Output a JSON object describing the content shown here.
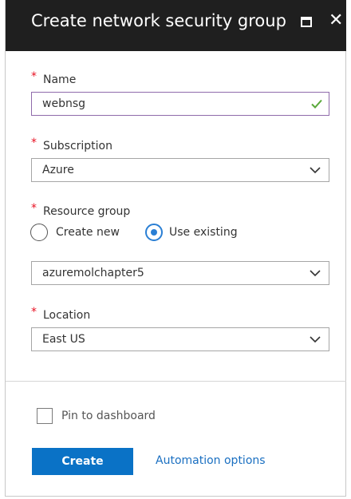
{
  "header": {
    "title": "Create network security group"
  },
  "form": {
    "name": {
      "required_mark": "*",
      "label": "Name",
      "value": "webnsg"
    },
    "subscription": {
      "required_mark": "*",
      "label": "Subscription",
      "selected": "Azure"
    },
    "resource_group": {
      "required_mark": "*",
      "label": "Resource group",
      "options": [
        {
          "label": "Create new",
          "selected": false
        },
        {
          "label": "Use existing",
          "selected": true
        }
      ],
      "selected": "azuremolchapter5"
    },
    "location": {
      "required_mark": "*",
      "label": "Location",
      "selected": "East US"
    }
  },
  "footer": {
    "pin_label": "Pin to dashboard",
    "pin_checked": false,
    "create_label": "Create",
    "automation_label": "Automation options"
  },
  "colors": {
    "header_bg": "#1f1f1f",
    "required": "#e81123",
    "primary_button": "#0a72c6",
    "link": "#1a6fc1",
    "valid_check": "#5aa93b",
    "radio_selected": "#2a7fd4"
  },
  "icons": {
    "maximize": "maximize-icon",
    "close": "close-icon",
    "valid": "checkmark-icon",
    "dropdown": "chevron-down-icon"
  }
}
